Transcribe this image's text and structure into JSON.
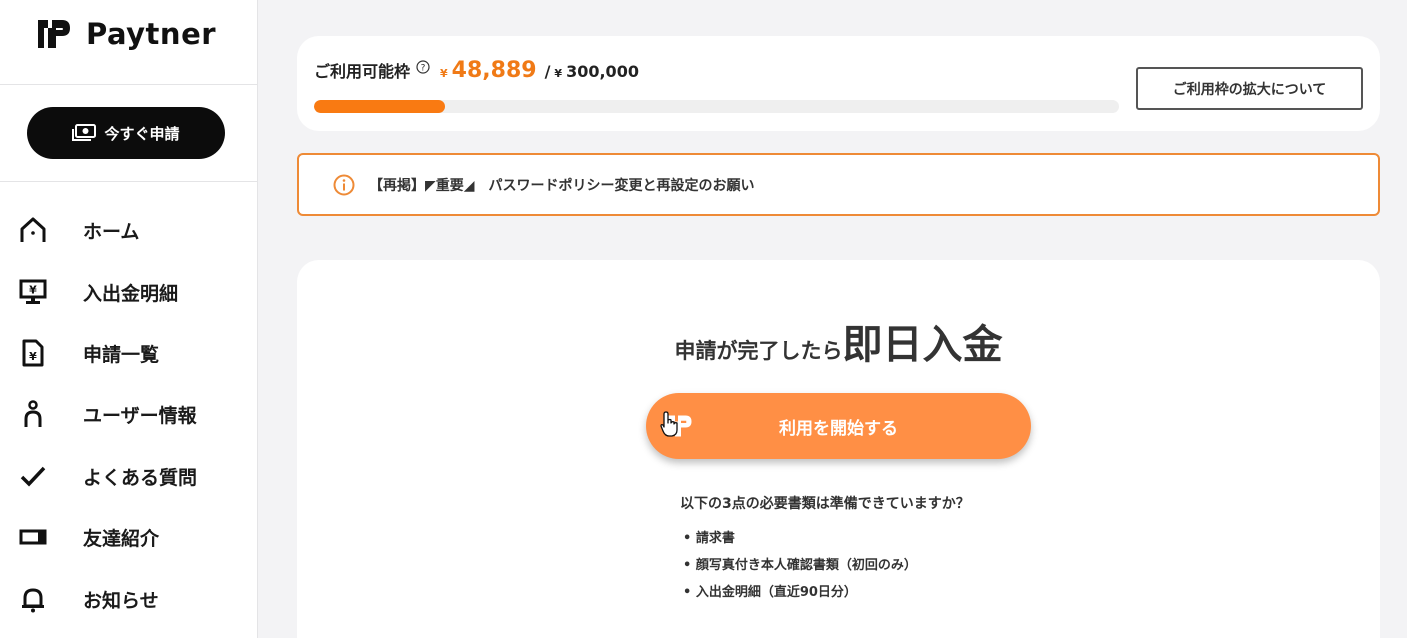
{
  "brand": {
    "name": "Paytner"
  },
  "sidebar": {
    "apply_button": "今すぐ申請",
    "items": [
      {
        "label": "ホーム",
        "icon": "home-icon"
      },
      {
        "label": "入出金明細",
        "icon": "monitor-yen-icon"
      },
      {
        "label": "申請一覧",
        "icon": "document-yen-icon"
      },
      {
        "label": "ユーザー情報",
        "icon": "user-icon"
      },
      {
        "label": "よくある質問",
        "icon": "check-icon"
      },
      {
        "label": "友達紹介",
        "icon": "ticket-icon"
      },
      {
        "label": "お知らせ",
        "icon": "bell-icon"
      }
    ]
  },
  "limit": {
    "label": "ご利用可能枠",
    "help_icon": "question-circle-icon",
    "currency": "¥",
    "available": "48,889",
    "separator": "/",
    "total": "300,000",
    "usage_fraction": 0.163,
    "expand_button": "ご利用枠の拡大について"
  },
  "notice": {
    "icon": "info-circle-icon",
    "text": "【再掲】◤重要◢　パスワードポリシー変更と再設定のお願い"
  },
  "hero": {
    "headline_small": "申請が完了したら",
    "headline_big": "即日入金",
    "start_button": "利用を開始する",
    "docs_question": "以下の3点の必要書類は準備できていますか？",
    "docs": [
      "• 請求書",
      "• 顔写真付き本人確認書類（初回のみ）",
      "• 入出金明細（直近90日分）"
    ]
  },
  "colors": {
    "accent": "#f07a16",
    "button_orange": "#ff8f45",
    "notice_border": "#ee8a36",
    "dark": "#0c0c0c"
  }
}
